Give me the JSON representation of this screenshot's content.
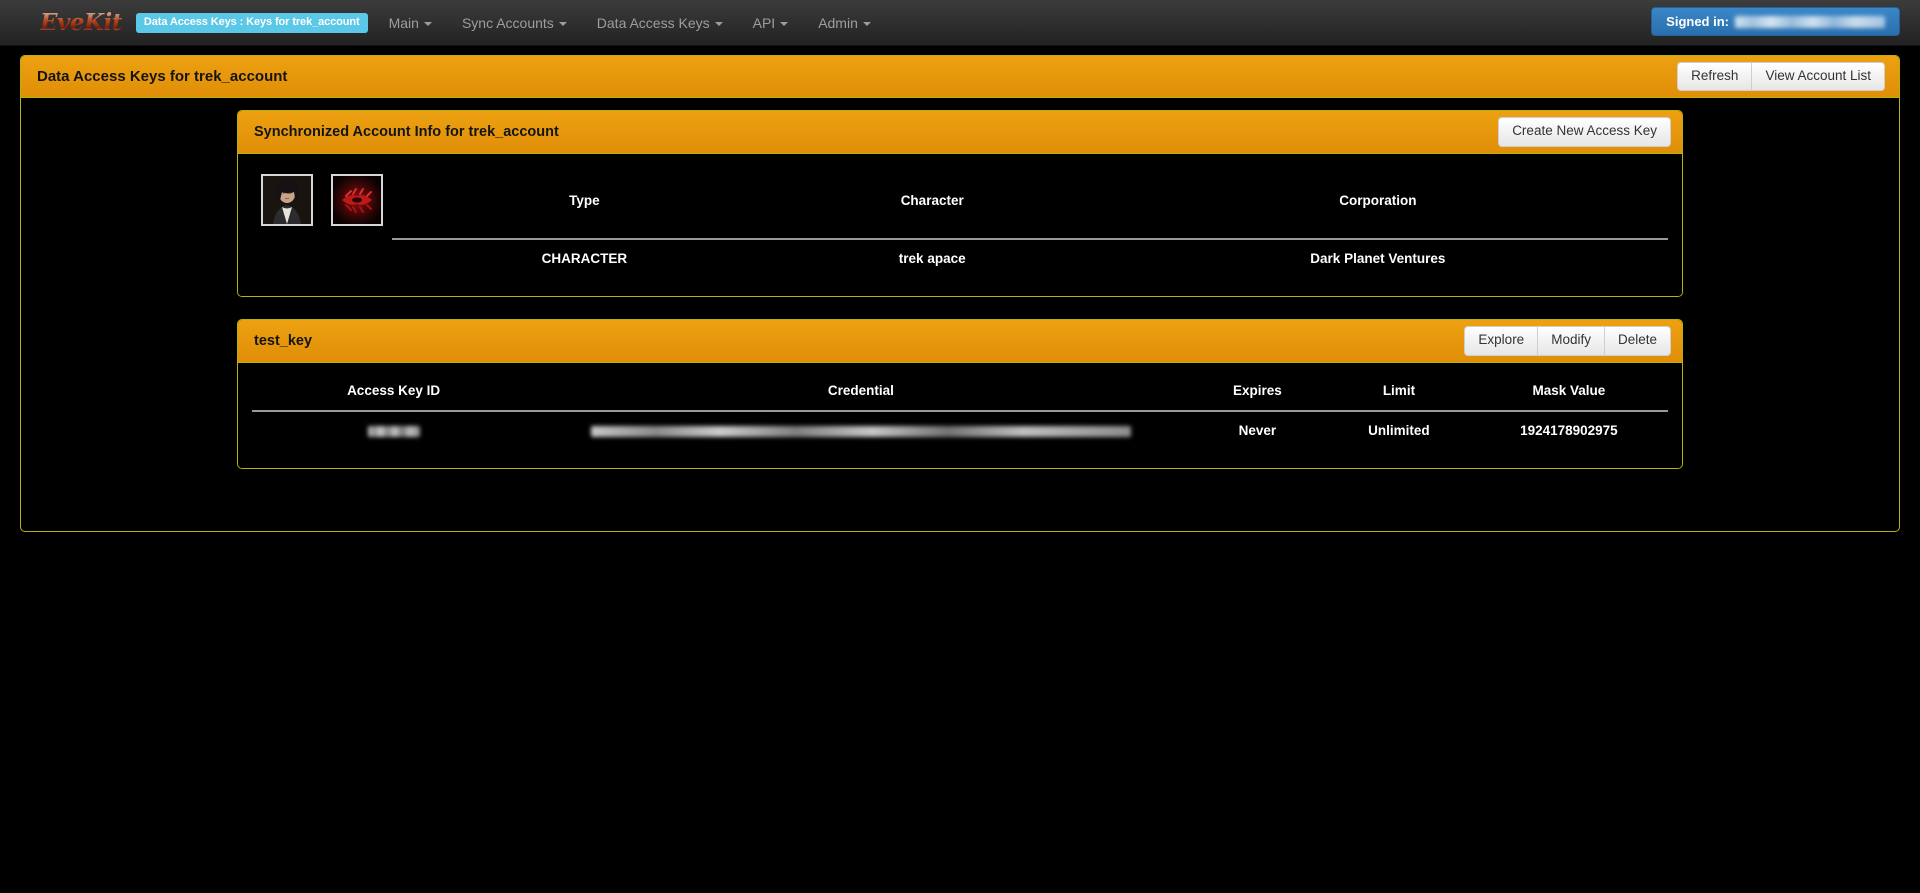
{
  "navbar": {
    "brand": "EveKit",
    "breadcrumb_badge": "Data Access Keys : Keys for trek_account",
    "links": [
      {
        "label": "Main",
        "icon": "chevron-down-icon"
      },
      {
        "label": "Sync Accounts",
        "icon": "chevron-down-icon"
      },
      {
        "label": "Data Access Keys",
        "icon": "chevron-down-icon"
      },
      {
        "label": "API",
        "icon": "chevron-down-icon"
      },
      {
        "label": "Admin",
        "icon": "chevron-down-icon"
      }
    ],
    "signed_in_label": "Signed in:",
    "signed_in_user": ""
  },
  "page_header": {
    "title": "Data Access Keys for trek_account",
    "refresh_label": "Refresh",
    "view_account_list_label": "View Account List"
  },
  "account_panel": {
    "title": "Synchronized Account Info for trek_account",
    "create_key_label": "Create New Access Key",
    "character_portrait_icon": "character-portrait-image",
    "corporation_logo_icon": "corporation-logo-image",
    "columns": [
      "Type",
      "Character",
      "Corporation"
    ],
    "rows": [
      {
        "type": "CHARACTER",
        "character": "trek apace",
        "corporation": "Dark Planet Ventures"
      }
    ]
  },
  "key_panel": {
    "title": "test_key",
    "actions": [
      "Explore",
      "Modify",
      "Delete"
    ],
    "columns": [
      "Access Key ID",
      "Credential",
      "Expires",
      "Limit",
      "Mask Value"
    ],
    "rows": [
      {
        "access_key_id": "",
        "credential": "",
        "expires": "Never",
        "limit": "Unlimited",
        "mask_value": "1924178902975"
      }
    ]
  },
  "colors": {
    "panel_orange": "#e8960c",
    "panel_border": "#b9b10c",
    "badge_cyan": "#5bc8e8",
    "signed_in_blue": "#2f7cbb",
    "page_background": "#000000"
  }
}
